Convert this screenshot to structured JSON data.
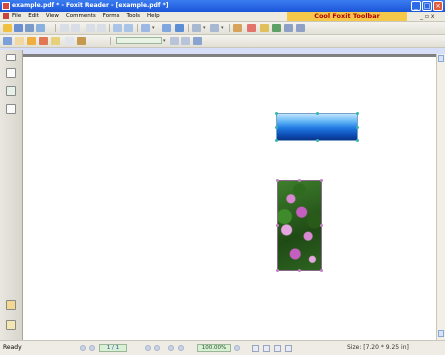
{
  "window": {
    "title": "example.pdf * - Foxit Reader - [example.pdf *]"
  },
  "menu": {
    "items": [
      "File",
      "Edit",
      "View",
      "Comments",
      "Forms",
      "Tools",
      "Help"
    ],
    "toolbar_banner": "Cool Foxit Toolbar",
    "controls": "_ ▫ x"
  },
  "toolbar": {
    "zoom_value": "",
    "dropdown_glyph": "▾"
  },
  "left_panel": {
    "buttons": [
      "pages-icon",
      "bookmarks-icon",
      "layers-icon",
      "attachment-icon",
      "signature-icon"
    ]
  },
  "page": {
    "images": [
      {
        "name": "water-image",
        "selected": true
      },
      {
        "name": "flower-image",
        "selected": true
      }
    ]
  },
  "status": {
    "ready": "Ready",
    "page_indicator": "1 / 1",
    "zoom": "100.00%",
    "size": "Size: [7.20 * 9.25 in]"
  },
  "colors": {
    "titlebar": "#1b55d8",
    "banner_bg": "#f5c84a",
    "banner_text": "#b00000",
    "selection_handle": "#35b8a8"
  }
}
